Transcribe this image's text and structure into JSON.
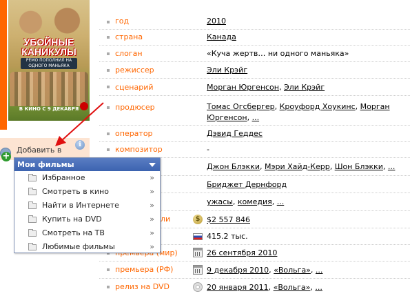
{
  "poster": {
    "title_line1": "УБОЙНЫЕ",
    "title_line2": "КАНИКУЛЫ",
    "subtitle": "РЕМО ПОПОЛНИЛ НА ОДНОГО МАНЬЯКА",
    "release_text": "В КИНО С 9 ДЕКАБРЯ"
  },
  "add_to": {
    "label": "Добавить в",
    "info_glyph": "i",
    "plus_glyph": "+"
  },
  "dropdown": {
    "header": "Мои фильмы",
    "items": [
      {
        "label": "Избранное",
        "arrow": "»"
      },
      {
        "label": "Смотреть в кино",
        "arrow": "»"
      },
      {
        "label": "Найти в Интернете",
        "arrow": "»"
      },
      {
        "label": "Купить на DVD",
        "arrow": "»"
      },
      {
        "label": "Смотреть на ТВ",
        "arrow": "»"
      },
      {
        "label": "Любимые фильмы",
        "arrow": "»"
      }
    ]
  },
  "info_rows": {
    "year": {
      "label": "год",
      "value": "2010"
    },
    "country": {
      "label": "страна",
      "value": "Канада"
    },
    "slogan": {
      "label": "слоган",
      "value": "«Куча жертв… ни одного маньяка»"
    },
    "director": {
      "label": "режиссер",
      "value": "Эли Крэйг"
    },
    "writer": {
      "label": "сценарий",
      "v1": "Морган Юргенсон",
      "sep": ", ",
      "v2": "Эли Крэйг"
    },
    "producer": {
      "label": "продюсер",
      "v1": "Томас Огсбергер",
      "v2": "Кроуфорд Хоукинс",
      "v3": "Морган",
      "v4": "Юргенсон",
      "more": "..."
    },
    "operator": {
      "label": "оператор",
      "value": "Дэвид Геддес"
    },
    "composer": {
      "label": "композитор",
      "value": "-"
    },
    "actors": {
      "v1": "Джон Блэкки",
      "v2": "Мэри Хайд-Керр",
      "v3": "Шон Блэкки",
      "more": "..."
    },
    "artist": {
      "value": "Бриджет Дернфорд"
    },
    "genre": {
      "v1": "ужасы",
      "v2": "комедия",
      "more": "..."
    },
    "budget": {
      "label_tail": "ли",
      "value": "$2 557 846"
    },
    "viewers": {
      "value": "415.2 тыс."
    },
    "premiere_world": {
      "label": "премьера (мир)",
      "value": "26 сентября 2010"
    },
    "premiere_rf": {
      "label": "премьера (РФ)",
      "date": "9 декабря 2010",
      "dist": "«Вольга»",
      "more": "..."
    },
    "dvd": {
      "label": "релиз на DVD",
      "date": "20 января 2011",
      "dist": "«Вольга»",
      "more": "..."
    }
  },
  "icons": {
    "dollar_glyph": "$"
  },
  "colors": {
    "accent": "#ff6600",
    "menu_header": "#3c63b0",
    "link": "#000000"
  }
}
